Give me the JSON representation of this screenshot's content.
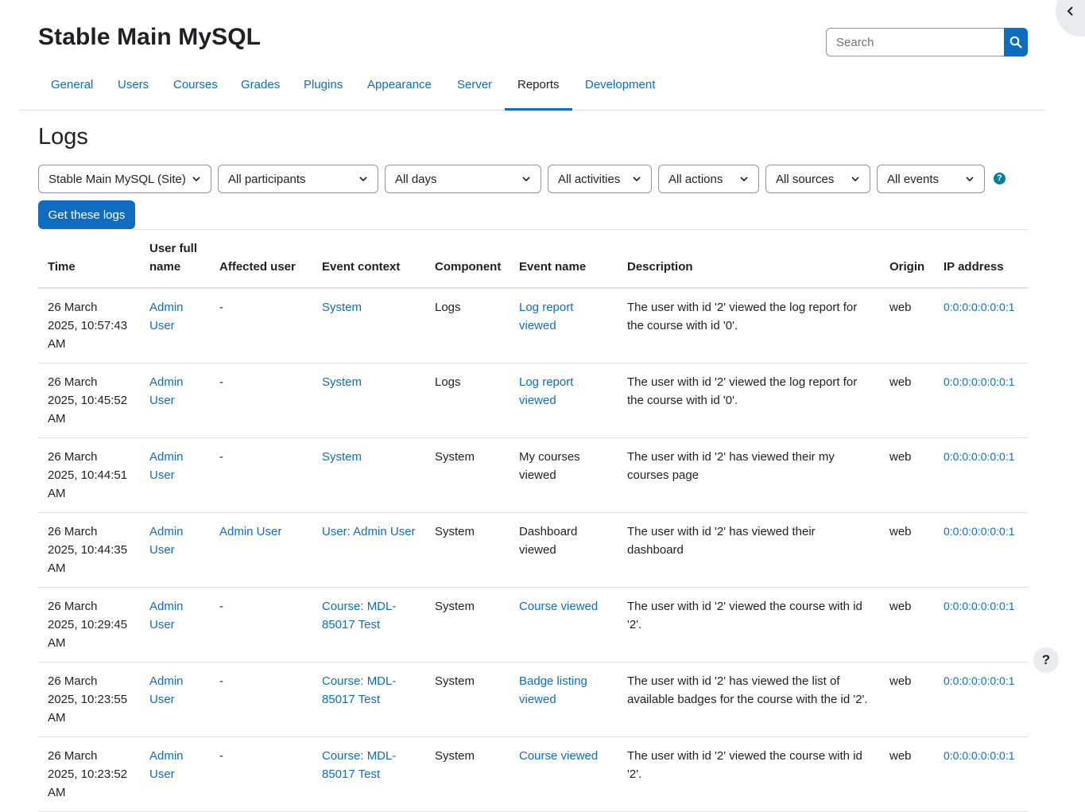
{
  "header": {
    "site_title": "Stable Main MySQL",
    "search_placeholder": "Search"
  },
  "nav": {
    "items": [
      {
        "label": "General"
      },
      {
        "label": "Users"
      },
      {
        "label": "Courses"
      },
      {
        "label": "Grades"
      },
      {
        "label": "Plugins"
      },
      {
        "label": "Appearance"
      },
      {
        "label": "Server"
      },
      {
        "label": "Reports"
      },
      {
        "label": "Development"
      }
    ],
    "active": "Reports"
  },
  "page": {
    "heading": "Logs"
  },
  "filters": {
    "site": "Stable Main MySQL (Site)",
    "participants": "All participants",
    "days": "All days",
    "activities": "All activities",
    "actions": "All actions",
    "sources": "All sources",
    "events": "All events",
    "submit": "Get these logs"
  },
  "table": {
    "headers": {
      "time": "Time",
      "user_full_name": "User full name",
      "affected_user": "Affected user",
      "event_context": "Event context",
      "component": "Component",
      "event_name": "Event name",
      "description": "Description",
      "origin": "Origin",
      "ip_address": "IP address"
    },
    "rows": [
      {
        "time": "26 March 2025, 10:57:43 AM",
        "user": "Admin User",
        "affected": "-",
        "context": "System",
        "component": "Logs",
        "event": "Log report viewed",
        "description": "The user with id '2' viewed the log report for the course with id '0'.",
        "origin": "web",
        "ip": "0:0:0:0:0:0:0:1"
      },
      {
        "time": "26 March 2025, 10:45:52 AM",
        "user": "Admin User",
        "affected": "-",
        "context": "System",
        "component": "Logs",
        "event": "Log report viewed",
        "description": "The user with id '2' viewed the log report for the course with id '0'.",
        "origin": "web",
        "ip": "0:0:0:0:0:0:0:1"
      },
      {
        "time": "26 March 2025, 10:44:51 AM",
        "user": "Admin User",
        "affected": "-",
        "context": "System",
        "component": "System",
        "event": "My courses viewed",
        "description": "The user with id '2' has viewed their my courses page",
        "origin": "web",
        "ip": "0:0:0:0:0:0:0:1"
      },
      {
        "time": "26 March 2025, 10:44:35 AM",
        "user": "Admin User",
        "affected": "Admin User",
        "context": "User: Admin User",
        "component": "System",
        "event": "Dashboard viewed",
        "description": "The user with id '2' has viewed their dashboard",
        "origin": "web",
        "ip": "0:0:0:0:0:0:0:1"
      },
      {
        "time": "26 March 2025, 10:29:45 AM",
        "user": "Admin User",
        "affected": "-",
        "context": "Course: MDL-85017 Test",
        "component": "System",
        "event": "Course viewed",
        "description": "The user with id '2' viewed the course with id '2'.",
        "origin": "web",
        "ip": "0:0:0:0:0:0:0:1"
      },
      {
        "time": "26 March 2025, 10:23:55 AM",
        "user": "Admin User",
        "affected": "-",
        "context": "Course: MDL-85017 Test",
        "component": "System",
        "event": "Badge listing viewed",
        "description": "The user with id '2' has viewed the list of available badges for the course with the id '2'.",
        "origin": "web",
        "ip": "0:0:0:0:0:0:0:1"
      },
      {
        "time": "26 March 2025, 10:23:52 AM",
        "user": "Admin User",
        "affected": "-",
        "context": "Course: MDL-85017 Test",
        "component": "System",
        "event": "Course viewed",
        "description": "The user with id '2' viewed the course with id '2'.",
        "origin": "web",
        "ip": "0:0:0:0:0:0:0:1"
      }
    ]
  },
  "colors": {
    "primary": "#0f6cbf",
    "info": "#008196"
  },
  "help_fab": "?"
}
